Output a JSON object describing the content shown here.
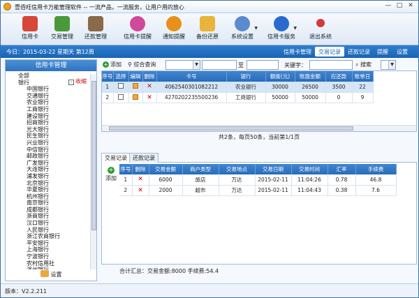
{
  "window": {
    "title": "壹佰旺信用卡万能管理软件 -- 一流产品，一流服务，让用户用的放心",
    "controls": [
      "—",
      "□",
      "✕"
    ]
  },
  "toolbar": [
    {
      "label": "信用卡",
      "icon": "credit-card-icon",
      "color": "#d8463a"
    },
    {
      "label": "交易管理",
      "icon": "basket-icon",
      "color": "#4a9a3a"
    },
    {
      "label": "还款管理",
      "icon": "clipboard-icon",
      "color": "#8a6a4a"
    },
    {
      "label": "信用卡提醒",
      "icon": "drop-icon",
      "color": "#d04a9a"
    },
    {
      "label": "通知提醒",
      "icon": "rss-icon",
      "color": "#e8901a"
    },
    {
      "label": "备份还原",
      "icon": "folder-icon",
      "color": "#e8b43a"
    },
    {
      "label": "系统设置",
      "icon": "gear-icon",
      "color": "#5a8ad0"
    },
    {
      "label": "信用卡服务",
      "icon": "globe-icon",
      "color": "#2a6ad0"
    },
    {
      "label": "退出系统",
      "icon": "pin-icon",
      "color": "#d03a3a"
    }
  ],
  "navbar": {
    "date_text": "今日：2015-03-22 星期天 第12周",
    "buttons": [
      "信用卡管理",
      "交易记录",
      "还款记录",
      "提醒",
      "设置"
    ]
  },
  "left_panel": {
    "header": "信用卡管理",
    "collapse_label": "收缩",
    "top_items": [
      "全部",
      "银行"
    ],
    "banks": [
      "中国银行",
      "交通银行",
      "农业银行",
      "工商银行",
      "建设银行",
      "招商银行",
      "光大银行",
      "民生银行",
      "兴业银行",
      "中信银行",
      "邮政银行",
      "广发银行",
      "大连银行",
      "浦发银行",
      "北京银行",
      "华夏银行",
      "杭州银行",
      "南京银行",
      "成都银行",
      "浙商银行",
      "汉口银行",
      "人民银行",
      "浙江农商银行",
      "平安银行",
      "上海银行",
      "宁波银行",
      "农村信用社",
      "温州银行"
    ],
    "settings_label": "设置"
  },
  "filter": {
    "add_label": "添加",
    "query_label": "综合查询",
    "to_label": "至",
    "keyword_label": "关键字：",
    "search_label": "搜索"
  },
  "cards_table": {
    "headers": [
      "序号",
      "选择",
      "编辑",
      "删除",
      "卡号",
      "银行",
      "额度(元)",
      "账面金额",
      "应还款",
      "账单日"
    ],
    "rows": [
      {
        "no": "1",
        "card": "4062540301082212",
        "bank": "农业银行",
        "limit": "30000",
        "balance": "26500",
        "due": "3500",
        "bill": "22"
      },
      {
        "no": "2",
        "card": "4270202235500236",
        "bank": "工商银行",
        "limit": "50000",
        "balance": "50000",
        "due": "0",
        "bill": "9"
      }
    ]
  },
  "pager": "共2条，每页50条，当前第1/1页",
  "tabs": [
    "交易记录",
    "还款记录"
  ],
  "trans_add": "添加",
  "trans_table": {
    "headers": [
      "序号",
      "删除",
      "交易金额",
      "商户类型",
      "交易地点",
      "交易日期",
      "交易时间",
      "汇率",
      "手续费"
    ],
    "rows": [
      {
        "no": "1",
        "amount": "6000",
        "type": "旅店",
        "place": "万达",
        "date": "2015-02-11",
        "time": "11:04:26",
        "rate": "0.78",
        "fee": "46.8"
      },
      {
        "no": "2",
        "amount": "2000",
        "type": "超市",
        "place": "万达",
        "date": "2015-02-11",
        "time": "11:04:43",
        "rate": "0.38",
        "fee": "7.6"
      }
    ]
  },
  "summary": "合计汇总：交易金额:8000  手续费:54.4",
  "status": "版本：V2.2.211"
}
